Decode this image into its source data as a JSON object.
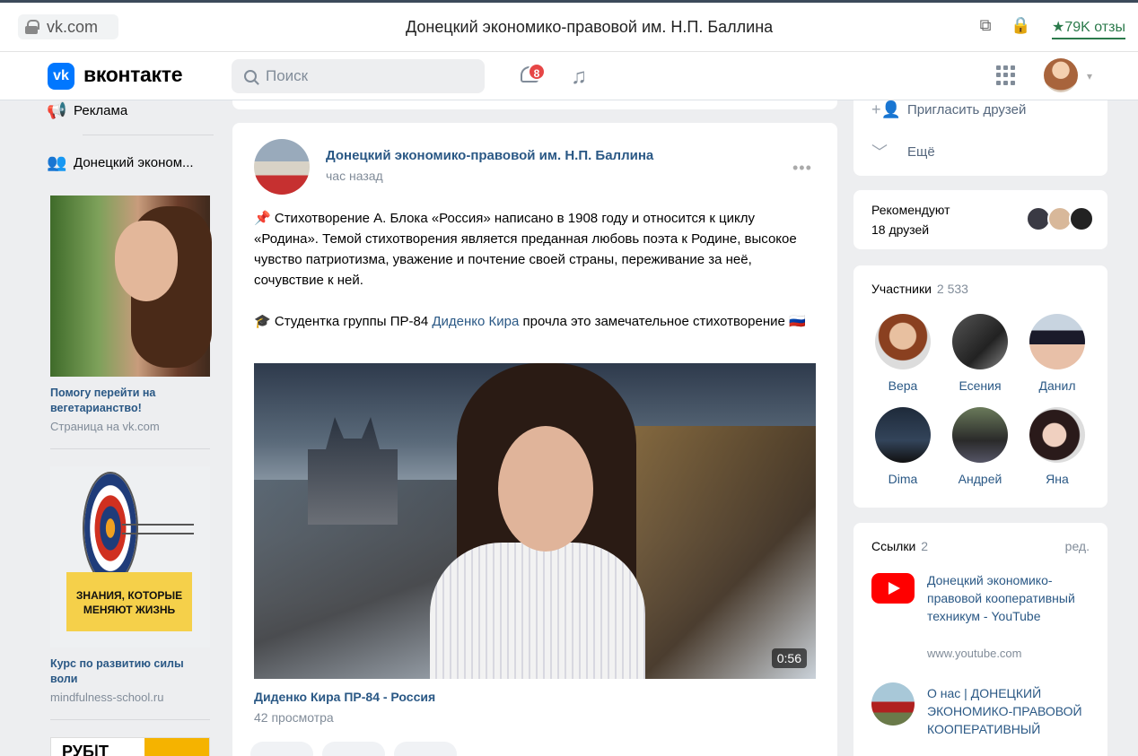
{
  "browser": {
    "url": "vk.com",
    "title": "Донецкий экономико-правовой им. Н.П. Баллина",
    "reviews": "★79K отзы"
  },
  "header": {
    "logo_mark": "vk",
    "logo_text": "вконтакте",
    "search_placeholder": "Поиск",
    "notifications_count": "8"
  },
  "left": {
    "items": [
      {
        "icon": "megaphone-icon",
        "label": "Реклама"
      },
      {
        "icon": "group-icon",
        "label": "Донецкий эконом..."
      }
    ],
    "ads": [
      {
        "title": "Помогу перейти на вегетарианство!",
        "sub": "Страница на vk.com"
      },
      {
        "title": "Курс по развитию силы воли",
        "sub": "mindfulness-school.ru",
        "banner": "ЗНАНИЯ, КОТОРЫЕ МЕНЯЮТ ЖИЗНЬ"
      }
    ],
    "third_ad_text": "РУБ|Т"
  },
  "post": {
    "author": "Донецкий экономико-правовой им. Н.П. Баллина",
    "time": "час назад",
    "more": "•••",
    "text1": "Стихотворение А. Блока «Россия» написано в 1908 году и относится к циклу «Родина». Темой стихотворения является преданная любовь поэта к Родине, высокое чувство патриотизма, уважение и почтение своей страны, переживание за неё, сочувствие к ней.",
    "text2_prefix": "Студентка группы ПР-84 ",
    "text2_link": "Диденко Кира",
    "text2_suffix": " прочла это замечательное стихотворение",
    "video": {
      "duration": "0:56",
      "title": "Диденко Кира ПР-84 - Россия",
      "views": "42 просмотра"
    }
  },
  "right": {
    "invite": "Пригласить друзей",
    "more": "Ещё",
    "recommend_line1": "Рекомендуют",
    "recommend_line2": "18 друзей",
    "members_title": "Участники",
    "members_count": "2 533",
    "members": [
      "Вера",
      "Есения",
      "Данил",
      "Dima",
      "Андрей",
      "Яна"
    ],
    "links_title": "Ссылки",
    "links_count": "2",
    "links_edit": "ред.",
    "links": [
      {
        "title": "Донецкий экономико-правовой кооперативный техникум - YouTube",
        "url": "www.youtube.com"
      },
      {
        "title": "О нас | ДОНЕЦКИЙ ЭКОНОМИКО-ПРАВОВОЙ КООПЕРАТИВНЫЙ"
      }
    ]
  }
}
